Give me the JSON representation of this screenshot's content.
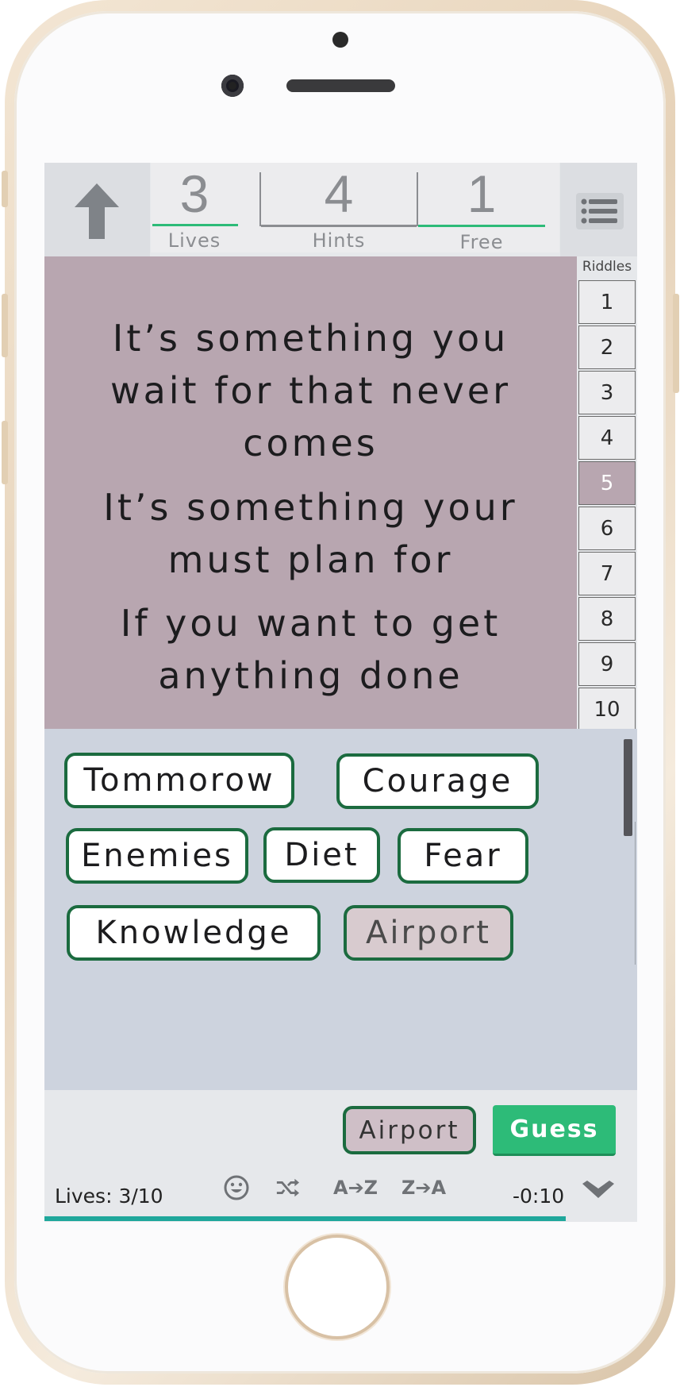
{
  "topbar": {
    "lives_value": "3",
    "lives_label": "Lives",
    "hints_value": "4",
    "hints_label": "Hints",
    "free_value": "1",
    "free_label": "Free"
  },
  "riddle": {
    "lines": [
      "It’s something you",
      "wait for that never",
      "comes",
      "It’s something your",
      "must plan for",
      "If you want to get",
      "anything done"
    ]
  },
  "riddles_nav": {
    "title": "Riddles",
    "items": [
      "1",
      "2",
      "3",
      "4",
      "5",
      "6",
      "7",
      "8",
      "9",
      "10"
    ],
    "active": "5"
  },
  "answers": [
    "Tommorow",
    "Courage",
    "Enemies",
    "Diet",
    "Fear",
    "Knowledge",
    "Airport"
  ],
  "used_answer": "Airport",
  "bottom": {
    "selected": "Airport",
    "guess_label": "Guess",
    "lives_text": "Lives: 3/10",
    "sort_az": "A➔Z",
    "sort_za": "Z➔A",
    "timer": "-0:10",
    "progress_fraction": 0.88
  },
  "icons": [
    "up-arrow-icon",
    "menu-icon",
    "smiley-icon",
    "shuffle-icon",
    "chevron-down-icon"
  ],
  "colors": {
    "riddle_bg": "#b8a6b0",
    "answer_bg": "#cdd3de",
    "chip_border": "#1b6b3f",
    "guess_bg": "#2dbb78",
    "progress": "#1fa79b",
    "stat_underline": "#2dbb78"
  }
}
